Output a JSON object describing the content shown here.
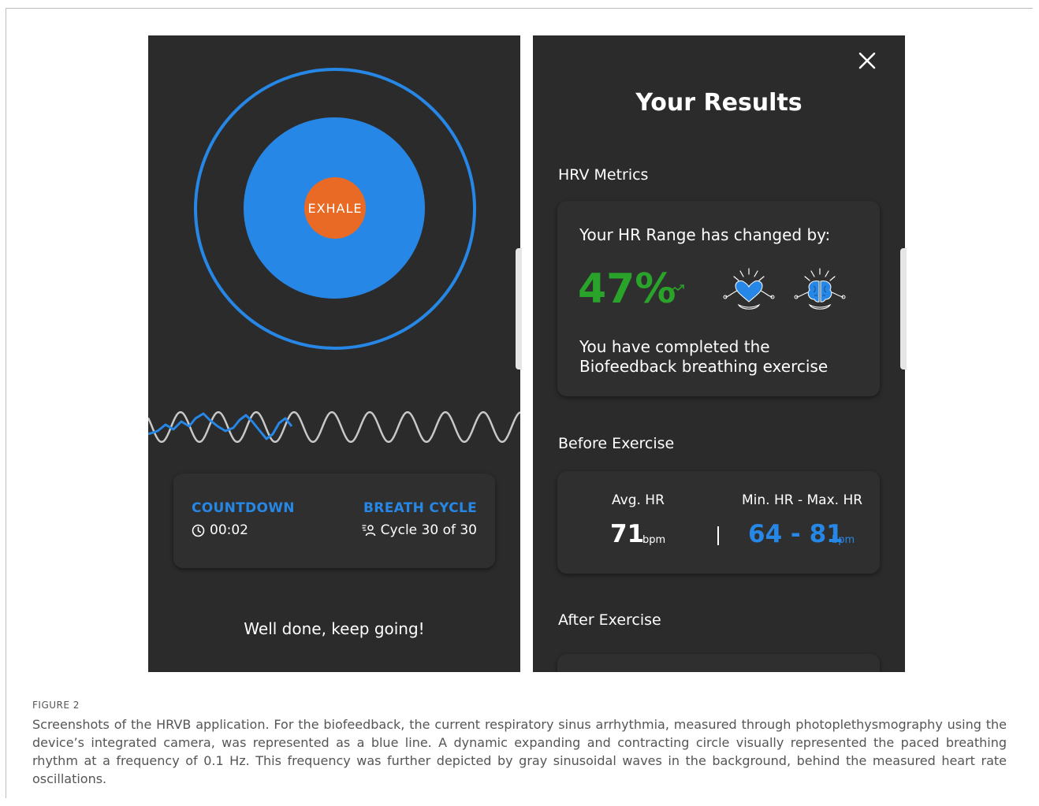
{
  "breathing_screen": {
    "phase_label": "EXHALE",
    "countdown_heading": "COUNTDOWN",
    "countdown_value": "00:02",
    "cycle_heading": "BREATH CYCLE",
    "cycle_value": "Cycle 30 of 30",
    "encouragement": "Well done, keep going!",
    "colors": {
      "accent_blue": "#2687e6",
      "exhale_orange": "#e86a25",
      "background": "#2b2b2b"
    },
    "icons": [
      "clock-icon",
      "person-breath-icon"
    ]
  },
  "results_screen": {
    "title": "Your Results",
    "hrv_section_label": "HRV Metrics",
    "hr_range_label": "Your HR Range has changed by:",
    "hr_range_change": "47%",
    "completion_message": "You have completed the Biofeedback breathing exercise",
    "before_section_label": "Before Exercise",
    "avg_hr_label": "Avg. HR",
    "avg_hr_value": "71",
    "avg_hr_unit": "bpm",
    "range_label": "Min. HR - Max. HR",
    "range_value": "64 - 81",
    "range_unit": "bpm",
    "after_section_label": "After Exercise",
    "colors": {
      "positive_green": "#29a32a",
      "accent_blue": "#2687e6"
    },
    "icons": [
      "close-icon",
      "trend-up-icon",
      "meditating-heart-icon",
      "meditating-brain-icon"
    ]
  },
  "figure": {
    "label": "FIGURE 2",
    "caption": "Screenshots of the HRVB application. For the biofeedback, the current respiratory sinus arrhythmia, measured through photoplethysmography using the device’s integrated camera, was represented as a blue line. A dynamic expanding and contracting circle visually represented the paced breathing rhythm at a frequency of 0.1 Hz. This frequency was further depicted by gray sinusoidal waves in the background, behind the measured heart rate oscillations."
  }
}
